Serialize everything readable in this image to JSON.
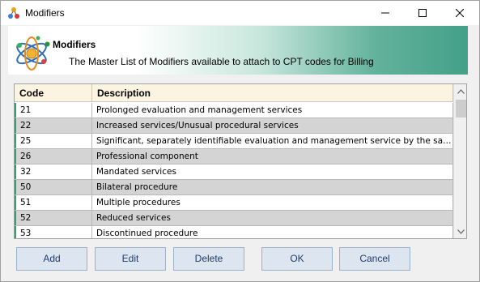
{
  "window": {
    "title": "Modifiers",
    "icon": "molecule-icon"
  },
  "banner": {
    "title": "Modifiers",
    "description": "The Master List of Modifiers available to attach to CPT codes for Billing",
    "logo": "atom-icon"
  },
  "grid": {
    "columns": [
      "Code",
      "Description"
    ],
    "rows": [
      {
        "code": "21",
        "description": "Prolonged evaluation and management services"
      },
      {
        "code": "22",
        "description": "Increased services/Unusual procedural services"
      },
      {
        "code": "25",
        "description": "Significant, separately identifiable evaluation and management service by the same p..."
      },
      {
        "code": "26",
        "description": "Professional component"
      },
      {
        "code": "32",
        "description": "Mandated services"
      },
      {
        "code": "50",
        "description": "Bilateral procedure"
      },
      {
        "code": "51",
        "description": "Multiple procedures"
      },
      {
        "code": "52",
        "description": "Reduced services"
      },
      {
        "code": "53",
        "description": "Discontinued procedure"
      }
    ]
  },
  "buttons": {
    "add": "Add",
    "edit": "Edit",
    "delete": "Delete",
    "ok": "OK",
    "cancel": "Cancel"
  },
  "colors": {
    "banner_gradient_end": "#44a088",
    "row_alt": "#d4d4d4",
    "header_bg": "#fbf4e1",
    "button_bg": "#dde6f0",
    "row_marker": "#3f9a70"
  }
}
